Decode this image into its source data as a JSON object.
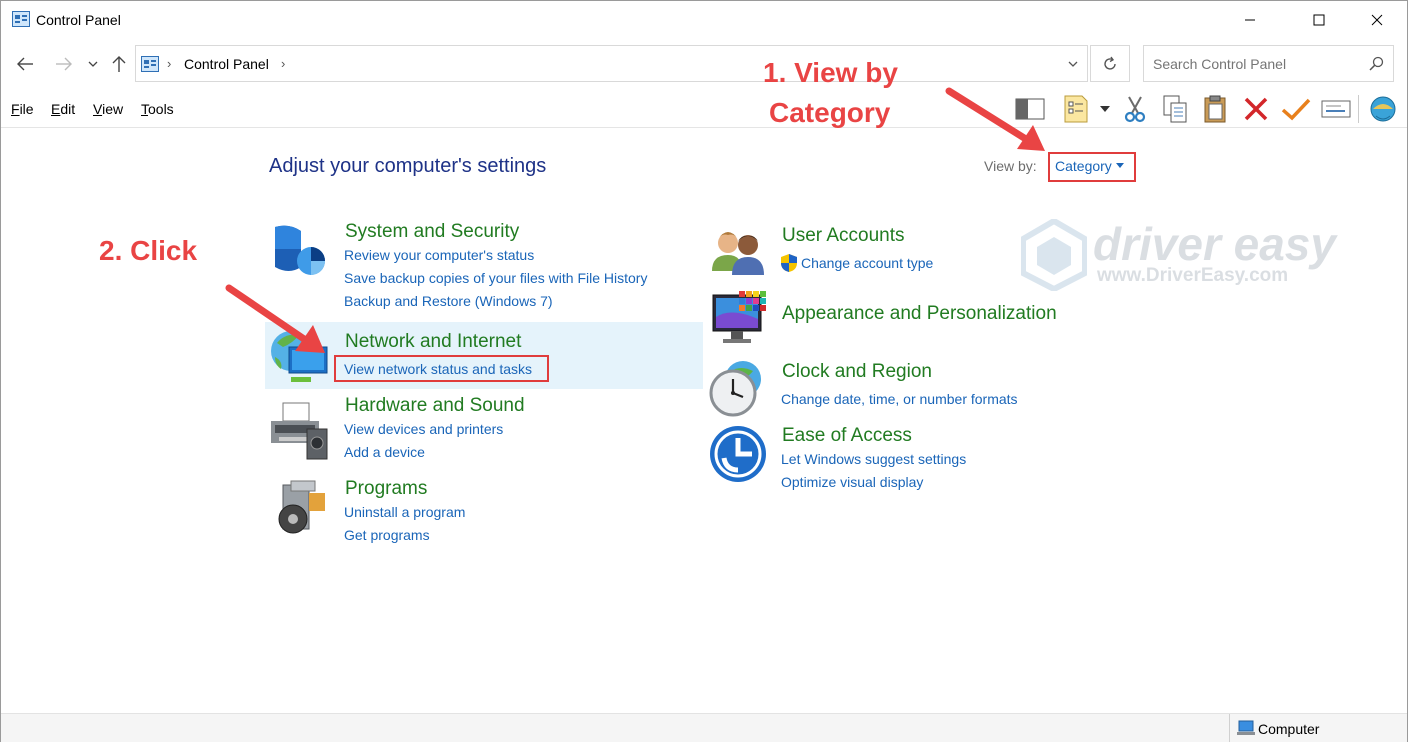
{
  "window": {
    "title": "Control Panel"
  },
  "address": {
    "crumb": "Control Panel",
    "search_placeholder": "Search Control Panel"
  },
  "menu": [
    {
      "accel": "F",
      "rest": "ile"
    },
    {
      "accel": "E",
      "rest": "dit"
    },
    {
      "accel": "V",
      "rest": "iew"
    },
    {
      "accel": "T",
      "rest": "ools"
    }
  ],
  "content": {
    "heading": "Adjust your computer's settings",
    "view_by_label": "View by:",
    "view_by_value": "Category"
  },
  "categories": {
    "system": {
      "title": "System and Security",
      "links": [
        "Review your computer's status",
        "Save backup copies of your files with File History",
        "Backup and Restore (Windows 7)"
      ]
    },
    "network": {
      "title": "Network and Internet",
      "links": [
        "View network status and tasks"
      ]
    },
    "hardware": {
      "title": "Hardware and Sound",
      "links": [
        "View devices and printers",
        "Add a device"
      ]
    },
    "programs": {
      "title": "Programs",
      "links": [
        "Uninstall a program",
        "Get programs"
      ]
    },
    "users": {
      "title": "User Accounts",
      "links": [
        "Change account type"
      ]
    },
    "appearance": {
      "title": "Appearance and Personalization",
      "links": []
    },
    "clock": {
      "title": "Clock and Region",
      "links": [
        "Change date, time, or number formats"
      ]
    },
    "ease": {
      "title": "Ease of Access",
      "links": [
        "Let Windows suggest settings",
        "Optimize visual display"
      ]
    }
  },
  "annotations": {
    "step1_line1": "1. View by",
    "step1_line2": "Category",
    "step2": "2. Click"
  },
  "watermark": {
    "brand": "driver easy",
    "url": "www.DriverEasy.com"
  },
  "statusbar": {
    "text": "Computer"
  },
  "colors": {
    "heading": "#1e3287",
    "category_title": "#217b21",
    "link": "#1a65b8",
    "annotation": "#e94444",
    "highlight": "#e5f3fb"
  }
}
